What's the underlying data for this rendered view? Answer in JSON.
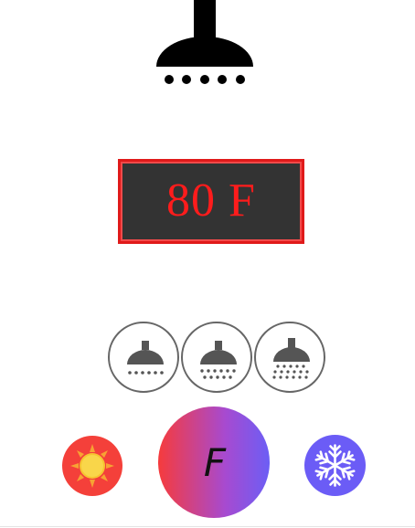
{
  "header": {
    "icon": "shower-head-icon"
  },
  "display": {
    "temperature_text": "80 F",
    "text_color": "#ff1c1c",
    "background": "#333333",
    "border_color": "#e01a1a"
  },
  "modes": [
    {
      "name": "light-spray",
      "icon": "shower-light-icon"
    },
    {
      "name": "medium-spray",
      "icon": "shower-medium-icon"
    },
    {
      "name": "heavy-spray",
      "icon": "shower-heavy-icon"
    }
  ],
  "controls": {
    "heat": {
      "icon": "sun-icon",
      "color": "#f4403a"
    },
    "unit": {
      "label": "F",
      "gradient": [
        "#f63b3c",
        "#6c5ef5"
      ]
    },
    "cold": {
      "icon": "snowflake-icon",
      "color": "#6b5cf6"
    }
  }
}
